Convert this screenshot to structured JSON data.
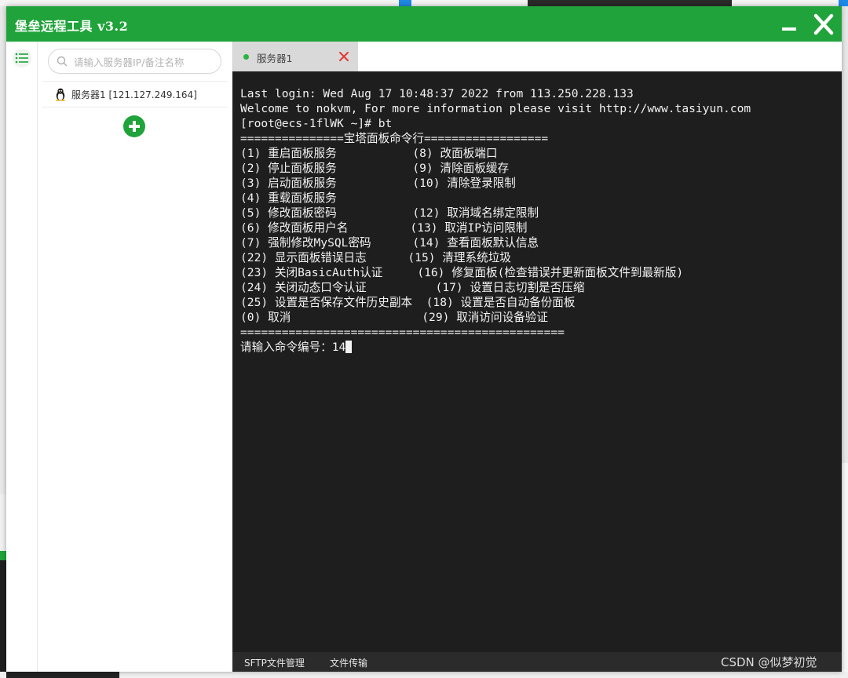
{
  "window": {
    "title": "堡垒远程工具 v3.2",
    "accent_color": "#21a33b"
  },
  "sidebar": {
    "menu_icon": "list-menu-icon",
    "search": {
      "placeholder": "请输入服务器IP/备注名称",
      "value": ""
    },
    "servers": [
      {
        "label": "服务器1 [121.127.249.164]",
        "icon": "linux-penguin-icon"
      }
    ],
    "add_icon": "plus-circle-icon"
  },
  "tabs": [
    {
      "label": "服务器1",
      "status_color": "#2bb33f"
    }
  ],
  "terminal": {
    "lines": [
      "Last login: Wed Aug 17 10:48:37 2022 from 113.250.228.133",
      "Welcome to nokvm, For more information please visit http://www.tasiyun.com",
      "[root@ecs-1flWK ~]# bt",
      "===============宝塔面板命令行==================",
      "(1) 重启面板服务           (8) 改面板端口",
      "(2) 停止面板服务           (9) 清除面板缓存",
      "(3) 启动面板服务           (10) 清除登录限制",
      "(4) 重载面板服务",
      "(5) 修改面板密码           (12) 取消域名绑定限制",
      "(6) 修改面板用户名         (13) 取消IP访问限制",
      "(7) 强制修改MySQL密码      (14) 查看面板默认信息",
      "(22) 显示面板错误日志      (15) 清理系统垃圾",
      "(23) 关闭BasicAuth认证     (16) 修复面板(检查错误并更新面板文件到最新版)",
      "(24) 关闭动态口令认证          (17) 设置日志切割是否压缩",
      "(25) 设置是否保存文件历史副本  (18) 设置是否自动备份面板",
      "(0) 取消                   (29) 取消访问设备验证",
      "===============================================",
      "请输入命令编号：14"
    ]
  },
  "bottom_tabs": [
    "SFTP文件管理",
    "文件传输"
  ],
  "watermark": "CSDN @似梦初觉"
}
